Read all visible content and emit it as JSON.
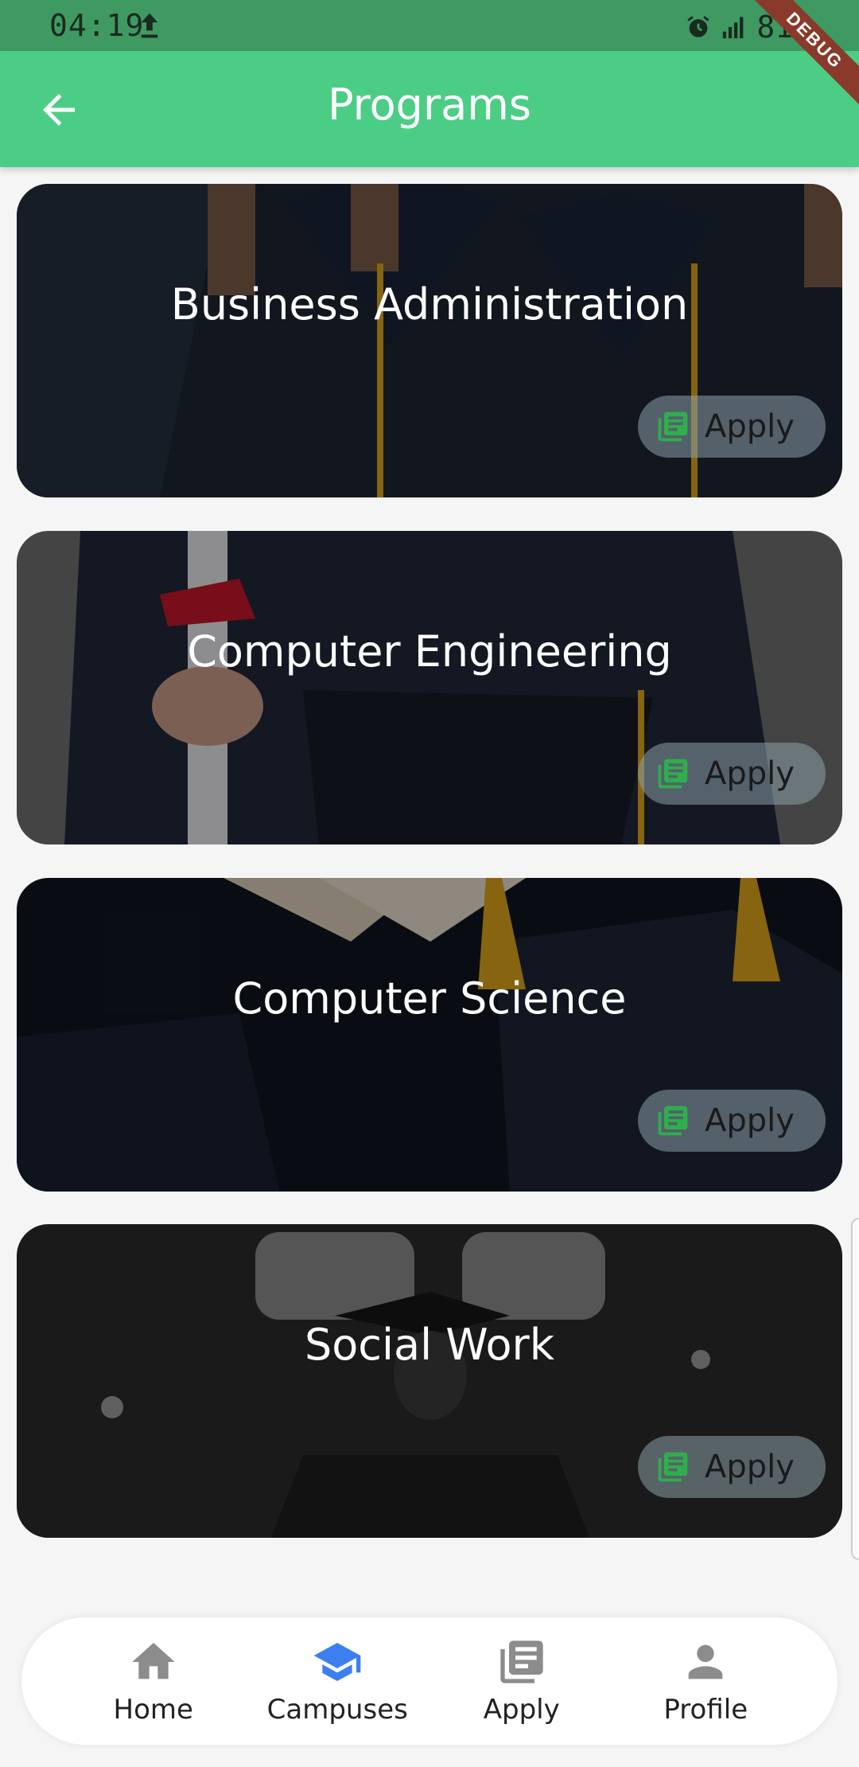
{
  "status_bar": {
    "time": "04:19",
    "battery": "81%"
  },
  "debug_label": "DEBUG",
  "app_bar": {
    "title": "Programs"
  },
  "programs": [
    {
      "name": "Business Administration",
      "action": "Apply"
    },
    {
      "name": "Computer Engineering",
      "action": "Apply"
    },
    {
      "name": "Computer Science",
      "action": "Apply"
    },
    {
      "name": "Social Work",
      "action": "Apply"
    }
  ],
  "bottom_nav": {
    "items": [
      {
        "label": "Home",
        "icon": "home-icon",
        "active": false
      },
      {
        "label": "Campuses",
        "icon": "graduation-cap-icon",
        "active": true
      },
      {
        "label": "Apply",
        "icon": "library-books-icon",
        "active": false
      },
      {
        "label": "Profile",
        "icon": "person-icon",
        "active": false
      }
    ]
  },
  "colors": {
    "app_bar": "#4ccd86",
    "accent_active": "#3d7ff0",
    "nav_inactive": "#8c8c8c",
    "apply_icon": "#2fae4c"
  }
}
